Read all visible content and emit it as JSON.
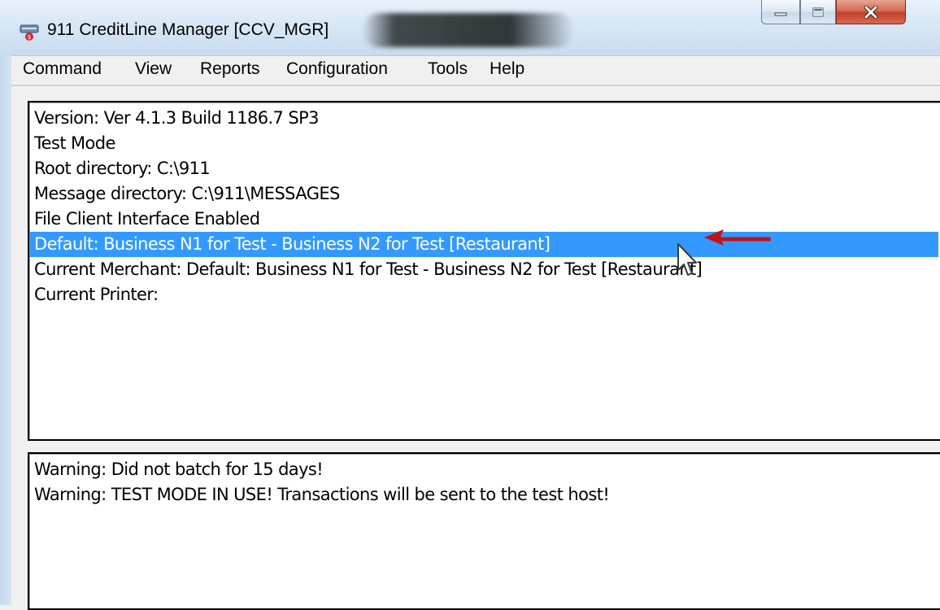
{
  "window": {
    "title": "911 CreditLine Manager [CCV_MGR]",
    "icon": "credit-card-app-icon",
    "buttons": [
      "minimize-icon",
      "maximize-icon",
      "close-icon"
    ]
  },
  "menu": {
    "items": [
      {
        "label": "Command"
      },
      {
        "label": "View"
      },
      {
        "label": "Reports"
      },
      {
        "label": "Configuration"
      },
      {
        "label": "Tools"
      },
      {
        "label": "Help"
      }
    ]
  },
  "info": {
    "lines": [
      "Version: Ver 4.1.3 Build 1186.7 SP3",
      "Test Mode",
      "Root directory: C:\\911",
      "Message directory: C:\\911\\MESSAGES",
      "File Client Interface Enabled",
      "Default: Business N1 for Test - Business N2 for Test [Restaurant]",
      "Current Merchant: Default: Business N1 for Test - Business N2 for Test [Restaurant]",
      "Current Printer:"
    ],
    "selected_index": 5
  },
  "messages": {
    "lines": [
      "Warning: Did not batch for 15 days!",
      "Warning: TEST MODE IN USE! Transactions will be sent to the test host!"
    ]
  },
  "colors": {
    "selection": "#3399ff",
    "arrow": "#c0141b"
  }
}
